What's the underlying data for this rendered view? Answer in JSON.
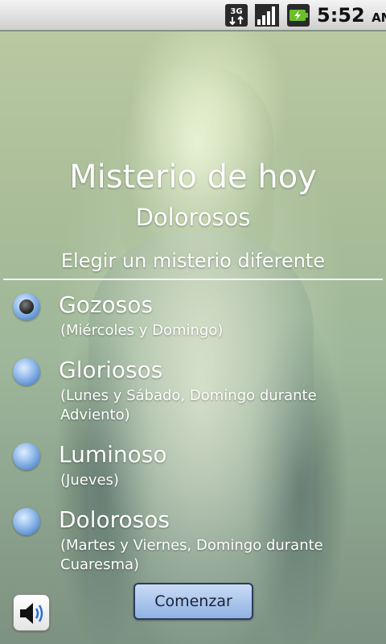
{
  "status_bar": {
    "network": "3G",
    "time": "5:52",
    "ampm": "AM",
    "icons": [
      "network-3g-icon",
      "signal-icon",
      "battery-charging-icon"
    ]
  },
  "header": {
    "title": "Misterio de hoy",
    "today_mystery": "Dolorosos",
    "choose_prompt": "Elegir un misterio diferente"
  },
  "options": [
    {
      "label": "Gozosos",
      "sub": "(Miércoles y Domingo)",
      "checked": true
    },
    {
      "label": "Gloriosos",
      "sub": "(Lunes y Sábado, Domingo durante Adviento)",
      "checked": false
    },
    {
      "label": "Luminoso",
      "sub": "(Jueves)",
      "checked": false
    },
    {
      "label": "Dolorosos",
      "sub": "(Martes y Viernes, Domingo durante Cuaresma)",
      "checked": false
    }
  ],
  "actions": {
    "start_label": "Comenzar",
    "speaker_icon": "speaker-icon"
  }
}
